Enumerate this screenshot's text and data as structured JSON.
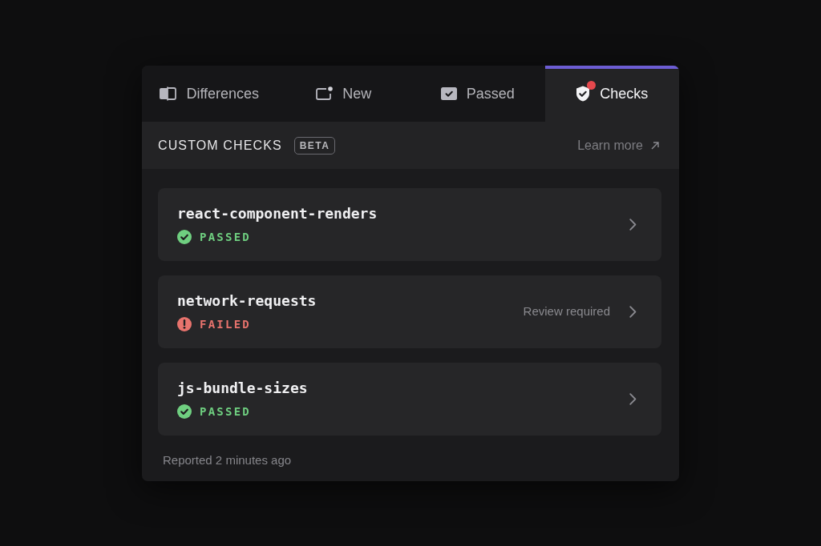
{
  "tabs": [
    {
      "label": "Differences",
      "selected": false,
      "alert": false
    },
    {
      "label": "New",
      "selected": false,
      "alert": false
    },
    {
      "label": "Passed",
      "selected": false,
      "alert": false
    },
    {
      "label": "Checks",
      "selected": true,
      "alert": true
    }
  ],
  "section": {
    "title": "CUSTOM CHECKS",
    "badge": "BETA",
    "link": "Learn more"
  },
  "checks": [
    {
      "name": "react-component-renders",
      "kind": "passed",
      "status": "PASSED"
    },
    {
      "name": "network-requests",
      "kind": "failed",
      "status": "FAILED",
      "note": "Review required"
    },
    {
      "name": "js-bundle-sizes",
      "kind": "passed",
      "status": "PASSED"
    }
  ],
  "footer": "Reported 2 minutes ago"
}
